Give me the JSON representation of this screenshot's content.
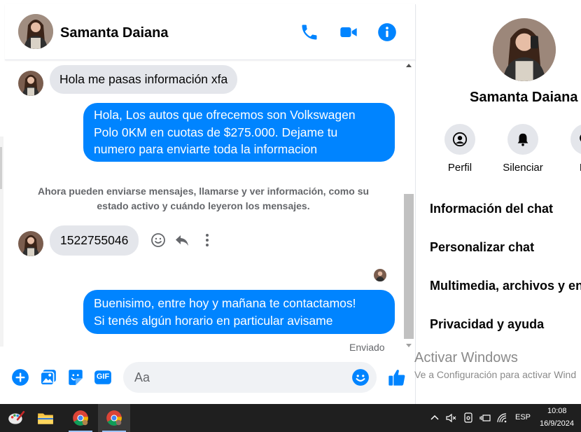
{
  "header": {
    "contact_name": "Samanta Daiana",
    "icons": [
      "phone-icon",
      "video-icon",
      "info-icon"
    ]
  },
  "messages": {
    "incoming_1": "Hola me pasas información xfa",
    "outgoing_1_line1": "Hola, Los autos que ofrecemos son Volkswagen",
    "outgoing_1_line2": "Polo 0KM en cuotas de $275.000. Dejame tu",
    "outgoing_1_line3": "numero para enviarte toda la informacion",
    "system_line1": "Ahora pueden enviarse mensajes, llamarse y ver información, como su",
    "system_line2": "estado activo y cuándo leyeron los mensajes.",
    "incoming_2": "1522755046",
    "outgoing_2_line1": "Buenisimo, entre hoy y mañana te contactamos!",
    "outgoing_2_line2": "Si tenés algún horario en particular avisame",
    "status": "Enviado"
  },
  "composer": {
    "placeholder": "Aa",
    "icons": [
      "plus-icon",
      "image-icon",
      "sticker-icon",
      "gif-icon",
      "emoji-icon",
      "like-icon"
    ],
    "gif_label": "GIF"
  },
  "info_panel": {
    "name": "Samanta Daiana",
    "actions": [
      {
        "label": "Perfil",
        "icon": "profile-icon"
      },
      {
        "label": "Silenciar",
        "icon": "bell-icon"
      },
      {
        "label": "Bu",
        "icon": "search-icon"
      }
    ],
    "menu": [
      "Información del chat",
      "Personalizar chat",
      "Multimedia, archivos y en",
      "Privacidad y ayuda"
    ]
  },
  "watermark": {
    "title": "Activar Windows",
    "subtitle": "Ve a Configuración para activar Wind"
  },
  "taskbar": {
    "language": "ESP",
    "time": "10:08",
    "date": "16/9/2024"
  },
  "colors": {
    "accent": "#0084ff",
    "incoming_bubble": "#e4e6eb",
    "taskbar": "#1f1f1f"
  }
}
